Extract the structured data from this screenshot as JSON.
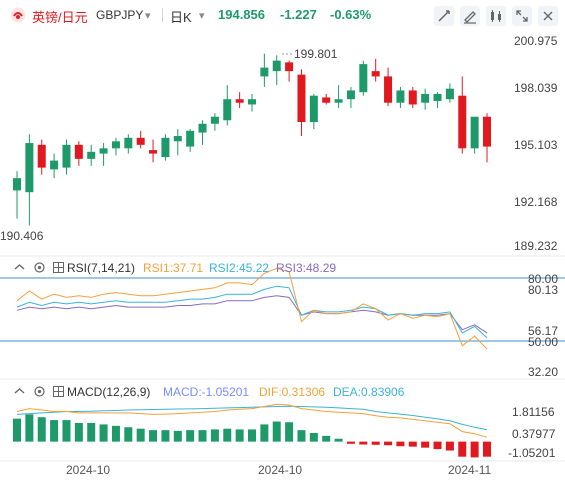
{
  "header": {
    "symbol_cn": "英镑/日元",
    "symbol_code": "GBPJPY",
    "dropdown_glyph": "▾",
    "timeframe": "日K",
    "price": "194.856",
    "change": "-1.227",
    "change_pct": "-0.63%",
    "colors": {
      "down": "#e0191f",
      "up": "#1e9a6a"
    }
  },
  "main_panel": {
    "y_ticks": [
      "200.975",
      "198.039",
      "195.103",
      "192.168",
      "189.232"
    ],
    "high_label": "199.801",
    "low_label": "190.406"
  },
  "rsi_panel": {
    "title": "RSI(7,14,21)",
    "rsi1": "RSI1:37.71",
    "rsi2": "RSI2:45.22",
    "rsi3": "RSI3:48.29",
    "y_ticks": [
      "80.00",
      "80.13",
      "56.17",
      "50.00",
      "32.20"
    ],
    "colors": {
      "rsi1": "#f4a13a",
      "rsi2": "#3bb3d9",
      "rsi3": "#8a6ac0",
      "level": "#3b8fd9"
    }
  },
  "macd_panel": {
    "title": "MACD(12,26,9)",
    "macd": "MACD:-1.05201",
    "dif": "DIF:0.31306",
    "dea": "DEA:0.83906",
    "y_ticks": [
      "1.81156",
      "0.37977",
      "-1.05201"
    ],
    "colors": {
      "macd": "#7a8cff",
      "dif": "#f4a13a",
      "dea": "#3bb3d9"
    }
  },
  "x_axis": {
    "labels": [
      "2024-10",
      "2024-10",
      "2024-11"
    ]
  },
  "chart_data": {
    "type": "candlestick",
    "candles": [
      {
        "o": 192.4,
        "h": 193.5,
        "l": 190.8,
        "c": 193.1
      },
      {
        "o": 192.3,
        "h": 195.6,
        "l": 190.4,
        "c": 195.1
      },
      {
        "o": 195.0,
        "h": 195.3,
        "l": 193.3,
        "c": 193.7
      },
      {
        "o": 193.6,
        "h": 194.5,
        "l": 193.1,
        "c": 194.1
      },
      {
        "o": 193.7,
        "h": 195.3,
        "l": 193.3,
        "c": 195.0
      },
      {
        "o": 195.0,
        "h": 195.2,
        "l": 193.8,
        "c": 194.2
      },
      {
        "o": 194.2,
        "h": 195.0,
        "l": 193.8,
        "c": 194.6
      },
      {
        "o": 194.5,
        "h": 195.1,
        "l": 193.8,
        "c": 194.8
      },
      {
        "o": 194.8,
        "h": 195.4,
        "l": 194.4,
        "c": 195.2
      },
      {
        "o": 194.8,
        "h": 195.6,
        "l": 194.5,
        "c": 195.4
      },
      {
        "o": 195.4,
        "h": 195.8,
        "l": 194.8,
        "c": 195.0
      },
      {
        "o": 194.7,
        "h": 195.3,
        "l": 194.0,
        "c": 194.5
      },
      {
        "o": 194.3,
        "h": 195.6,
        "l": 194.1,
        "c": 195.4
      },
      {
        "o": 195.2,
        "h": 195.9,
        "l": 194.4,
        "c": 195.5
      },
      {
        "o": 194.9,
        "h": 195.9,
        "l": 194.6,
        "c": 195.8
      },
      {
        "o": 195.7,
        "h": 196.4,
        "l": 195.0,
        "c": 196.2
      },
      {
        "o": 196.2,
        "h": 196.8,
        "l": 195.8,
        "c": 196.6
      },
      {
        "o": 196.4,
        "h": 198.4,
        "l": 196.1,
        "c": 197.6
      },
      {
        "o": 197.6,
        "h": 198.0,
        "l": 197.1,
        "c": 197.4
      },
      {
        "o": 197.3,
        "h": 197.9,
        "l": 196.9,
        "c": 197.6
      },
      {
        "o": 198.9,
        "h": 200.2,
        "l": 198.3,
        "c": 199.4
      },
      {
        "o": 199.2,
        "h": 200.1,
        "l": 198.4,
        "c": 199.8
      },
      {
        "o": 199.7,
        "h": 199.8,
        "l": 198.6,
        "c": 199.2
      },
      {
        "o": 199.0,
        "h": 199.3,
        "l": 195.5,
        "c": 196.3
      },
      {
        "o": 196.3,
        "h": 197.9,
        "l": 195.9,
        "c": 197.8
      },
      {
        "o": 197.7,
        "h": 197.9,
        "l": 197.3,
        "c": 197.4
      },
      {
        "o": 197.4,
        "h": 198.4,
        "l": 197.1,
        "c": 197.6
      },
      {
        "o": 197.6,
        "h": 198.3,
        "l": 197.1,
        "c": 198.1
      },
      {
        "o": 198.0,
        "h": 199.8,
        "l": 197.8,
        "c": 199.6
      },
      {
        "o": 199.2,
        "h": 199.9,
        "l": 198.6,
        "c": 198.9
      },
      {
        "o": 198.9,
        "h": 199.4,
        "l": 197.2,
        "c": 197.4
      },
      {
        "o": 197.4,
        "h": 198.3,
        "l": 197.1,
        "c": 198.1
      },
      {
        "o": 198.1,
        "h": 198.3,
        "l": 197.1,
        "c": 197.3
      },
      {
        "o": 197.4,
        "h": 198.2,
        "l": 197.0,
        "c": 197.9
      },
      {
        "o": 197.5,
        "h": 198.0,
        "l": 197.1,
        "c": 197.9
      },
      {
        "o": 197.6,
        "h": 198.5,
        "l": 197.4,
        "c": 198.2
      },
      {
        "o": 197.8,
        "h": 198.9,
        "l": 194.5,
        "c": 194.8
      },
      {
        "o": 194.8,
        "h": 196.6,
        "l": 194.5,
        "c": 196.6
      },
      {
        "o": 196.6,
        "h": 196.8,
        "l": 194.0,
        "c": 194.9
      }
    ],
    "rsi1": [
      68,
      74,
      69,
      72,
      70,
      71,
      70,
      72,
      73,
      72,
      71,
      71,
      72,
      73,
      74,
      75,
      76,
      79,
      79,
      78,
      85,
      88,
      86,
      55,
      62,
      60,
      60,
      61,
      66,
      63,
      56,
      60,
      57,
      59,
      58,
      60,
      40,
      46,
      38
    ],
    "rsi2": [
      64,
      67,
      65,
      67,
      66,
      67,
      66,
      67,
      68,
      67,
      67,
      67,
      67,
      68,
      69,
      69,
      70,
      72,
      72,
      72,
      75,
      77,
      76,
      59,
      62,
      61,
      61,
      62,
      64,
      63,
      59,
      60,
      59,
      60,
      60,
      61,
      48,
      52,
      45
    ],
    "rsi3": [
      62,
      64,
      63,
      64,
      63,
      64,
      63,
      64,
      65,
      64,
      64,
      64,
      64,
      65,
      65,
      66,
      66,
      68,
      68,
      68,
      70,
      71,
      70,
      59,
      61,
      60,
      60,
      61,
      62,
      61,
      59,
      60,
      59,
      59,
      59,
      60,
      50,
      53,
      48
    ],
    "macd": [
      1.6,
      1.9,
      1.7,
      1.5,
      1.5,
      1.3,
      1.3,
      1.2,
      1.1,
      1.0,
      0.9,
      0.8,
      0.8,
      0.75,
      0.8,
      0.8,
      0.85,
      0.9,
      0.85,
      0.85,
      1.2,
      1.4,
      1.35,
      0.8,
      0.6,
      0.4,
      0.2,
      -0.15,
      -0.2,
      -0.22,
      -0.25,
      -0.32,
      -0.35,
      -0.42,
      -0.52,
      -0.62,
      -1.05,
      -1.1,
      -1.05
    ],
    "dif": [
      2.1,
      2.3,
      2.2,
      2.1,
      2.1,
      2.0,
      2.0,
      2.0,
      2.0,
      2.0,
      1.95,
      1.9,
      1.92,
      1.95,
      2.0,
      2.05,
      2.1,
      2.2,
      2.25,
      2.3,
      2.45,
      2.6,
      2.55,
      2.3,
      2.2,
      2.1,
      2.05,
      2.0,
      1.95,
      1.8,
      1.7,
      1.65,
      1.55,
      1.45,
      1.35,
      1.25,
      0.7,
      0.55,
      0.31
    ],
    "dea": [
      1.9,
      1.95,
      2.0,
      2.05,
      2.1,
      2.1,
      2.12,
      2.15,
      2.17,
      2.2,
      2.22,
      2.24,
      2.25,
      2.27,
      2.28,
      2.3,
      2.32,
      2.35,
      2.37,
      2.4,
      2.42,
      2.45,
      2.47,
      2.45,
      2.42,
      2.4,
      2.35,
      2.3,
      2.25,
      2.1,
      2.0,
      1.92,
      1.82,
      1.7,
      1.58,
      1.45,
      1.2,
      1.0,
      0.84
    ],
    "ylim_price": [
      189.232,
      200.975
    ],
    "ylim_rsi": [
      20,
      92
    ],
    "ylim_macd": [
      -1.35,
      2.9
    ]
  }
}
